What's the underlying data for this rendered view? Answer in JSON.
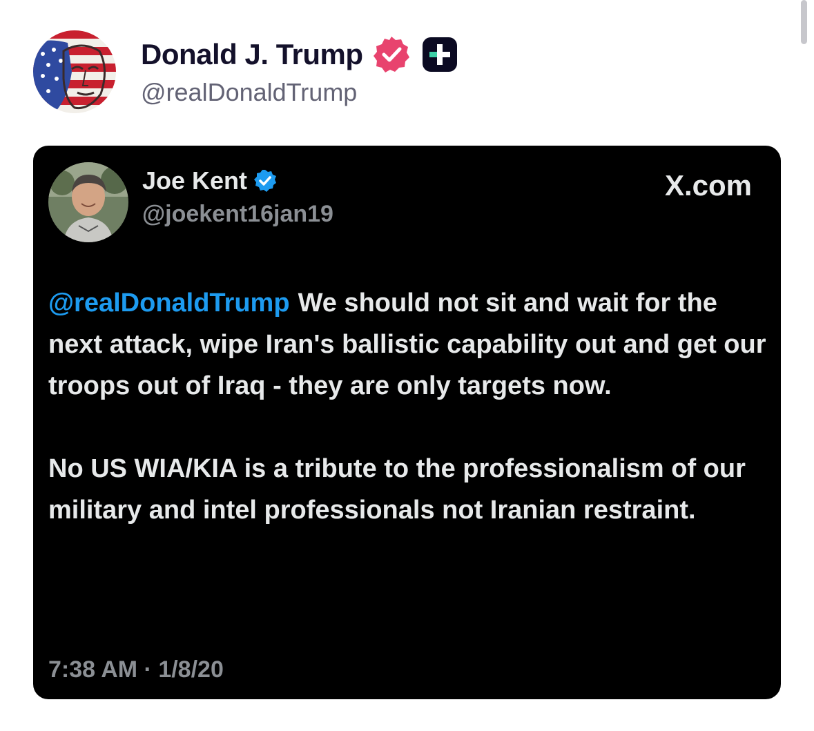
{
  "post": {
    "author": {
      "display_name": "Donald J. Trump",
      "handle": "@realDonaldTrump",
      "avatar_icon": "flag-portrait-avatar",
      "verified_icon": "verified-badge-icon",
      "verified_color": "#e8436e",
      "app_icon": "truth-social-plus-icon"
    }
  },
  "embedded_tweet": {
    "author": {
      "display_name": "Joe Kent",
      "handle": "@joekent16jan19",
      "avatar_icon": "profile-photo-avatar",
      "verified_icon": "blue-check-icon",
      "verified_color": "#1d9bf0"
    },
    "source": "X.com",
    "mention": "@realDonaldTrump",
    "paragraph1": "We should not sit and wait for the next attack, wipe Iran's ballistic capability out and get our troops out of Iraq - they are only targets now.",
    "paragraph2": "No US WIA/KIA is a tribute to the professionalism of our military and intel professionals not Iranian restraint.",
    "timestamp": "7:38 AM · 1/8/20"
  },
  "colors": {
    "card_background": "#000000",
    "mention": "#1d9bf0",
    "primary_text": "#e7e9ea",
    "secondary_text": "#8b8f94"
  }
}
